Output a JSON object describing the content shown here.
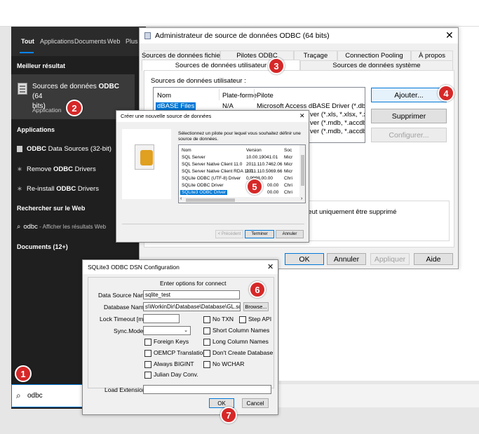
{
  "start_menu": {
    "tabs": [
      "Tout",
      "Applications",
      "Documents",
      "Web",
      "Plus ▾"
    ],
    "best_match_heading": "Meilleur résultat",
    "best_match_title": "Sources de données ODBC (64 bits)",
    "best_match_title_a": "Sources de données ",
    "best_match_title_b": "ODBC",
    "best_match_title_c": " (64",
    "best_match_title_d": "bits)",
    "best_match_sub": "Application",
    "apps_heading": "Applications",
    "apps": [
      {
        "pre": "",
        "bold": "ODBC",
        "post": " Data Sources (32-bit)"
      },
      {
        "pre": "Remove ",
        "bold": "ODBC",
        "post": " Drivers"
      },
      {
        "pre": "Re-install ",
        "bold": "ODBC",
        "post": " Drivers"
      }
    ],
    "web_heading": "Rechercher sur le Web",
    "web_query": "odbc",
    "web_hint": " - Afficher les résultats Web",
    "docs_heading": "Documents (12+)",
    "search_value": "odbc"
  },
  "odbc_admin": {
    "title": "Administrateur de source de données ODBC (64 bits)",
    "tabs_row1": [
      "Sources de données fichier",
      "Pilotes ODBC",
      "Traçage",
      "Connection Pooling",
      "À propos"
    ],
    "tabs_row2": [
      "Sources de données utilisateur",
      "Sources de données système"
    ],
    "list_label": "Sources de données utilisateur :",
    "columns": [
      "Nom",
      "Plate-forme",
      "Pilote"
    ],
    "rows": [
      {
        "name": "dBASE Files",
        "platform": "N/A",
        "driver": "Microsoft Access dBASE Driver (*.dbf, *.nd"
      },
      {
        "name": "",
        "platform": "",
        "driver": "ver (*.xls, *.xlsx, *.xlsm, *"
      },
      {
        "name": "",
        "platform": "",
        "driver": "ver (*.mdb, *.accdb)"
      },
      {
        "name": "",
        "platform": "",
        "driver": "ver (*.mdb, *.accdb)"
      }
    ],
    "btn_add": "Ajouter...",
    "btn_remove": "Supprimer",
    "btn_configure": "Configurer...",
    "info_text": "peut uniquement être supprimé",
    "btn_ok": "OK",
    "btn_cancel": "Annuler",
    "btn_apply": "Appliquer",
    "btn_help": "Aide"
  },
  "new_source": {
    "title": "Créer une nouvelle source de données",
    "instruction": "Sélectionnez un pilote pour lequel vous souhaitez définir une source de données.",
    "columns": [
      "Nom",
      "Version",
      "Soc"
    ],
    "drivers": [
      {
        "name": "SQL Server",
        "version": "10.00.19041.01",
        "co": "Micr"
      },
      {
        "name": "SQL Server Native Client 11.0",
        "version": "2011.110.7462.06",
        "co": "Micr"
      },
      {
        "name": "SQL Server Native Client RDA 11.0",
        "version": "2011.110.5069.66",
        "co": "Micr"
      },
      {
        "name": "SQLite ODBC (UTF-8) Driver",
        "version": "0.9998.00.00",
        "co": "Chri"
      },
      {
        "name": "SQLite ODBC Driver",
        "version": "00.00",
        "co": "Chri"
      },
      {
        "name": "SQLite3 ODBC Driver",
        "version": "00.00",
        "co": "Chri"
      }
    ],
    "btn_prev": "< Précédent",
    "btn_finish": "Terminer",
    "btn_cancel": "Annuler"
  },
  "sqlite_config": {
    "title": "SQLite3 ODBC DSN Configuration",
    "group_label": "Enter options for connect",
    "dsn_label": "Data Source Name:",
    "dsn_value": "sqlite_test",
    "db_label": "Database Name:",
    "db_value": "s\\WorkinDir\\Database\\Database\\GL.sqlite",
    "browse": "Browse...",
    "timeout_label": "Lock Timeout [ms]:",
    "timeout_value": "",
    "sync_label": "Sync.Mode:",
    "sync_value": "",
    "checks_left": [
      "Foreign Keys",
      "OEMCP Translation",
      "Always BIGINT",
      "Julian Day Conv."
    ],
    "checks_mid": [
      "No TXN",
      "Short Column Names",
      "Long Column Names",
      "Don't Create Database",
      "No WCHAR"
    ],
    "step_api": "Step API",
    "load_ext_label": "Load Extensions:",
    "load_ext_value": "",
    "btn_ok": "OK",
    "btn_cancel": "Cancel"
  },
  "badges": [
    "1",
    "2",
    "3",
    "4",
    "5",
    "6",
    "7"
  ]
}
